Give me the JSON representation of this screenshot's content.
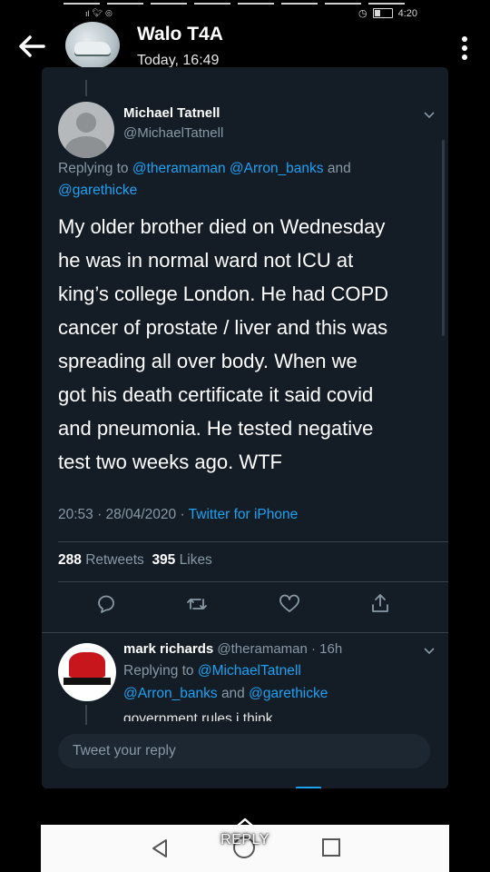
{
  "status_bar": {
    "left_icons": [
      "signal-icon",
      "twitter-icon",
      "whatsapp-icon"
    ],
    "time": "4:20"
  },
  "header": {
    "title": "Walo T4A",
    "subtitle": "Today, 16:49"
  },
  "tweet": {
    "author_name": "Michael Tatnell",
    "author_handle": "@MichaelTatnell",
    "replying_prefix": "Replying to",
    "replying_mentions": [
      "@theramaman",
      "@Arron_banks"
    ],
    "replying_and": "and",
    "replying_last": "@garethicke",
    "text": "My older brother died on Wednesday\nhe was in normal ward not ICU at\nking’s college London. He had COPD\ncancer of prostate / liver and this was\nspreading all over body. When we\ngot his death certificate it said covid\nand pneumonia. He tested negative\ntest two weeks ago. WTF",
    "timestamp": "20:53 · 28/04/2020 · ",
    "source": "Twitter for iPhone",
    "retweets_count": "288",
    "retweets_label": "Retweets",
    "likes_count": "395",
    "likes_label": "Likes"
  },
  "reply": {
    "author_name": "mark richards",
    "author_meta": "@theramaman · 16h",
    "replying_prefix": "Replying to",
    "mention_1": "@MichaelTatnell",
    "mention_2": "@Arron_banks",
    "and": "and",
    "mention_3": "@garethicke",
    "text": "government rules i think"
  },
  "composer": {
    "placeholder": "Tweet your reply"
  },
  "bottom": {
    "reply_label": "REPLY"
  },
  "colors": {
    "twitter_bg": "#141d26",
    "twitter_blue": "#1da1f2",
    "muted": "#8899a6"
  }
}
